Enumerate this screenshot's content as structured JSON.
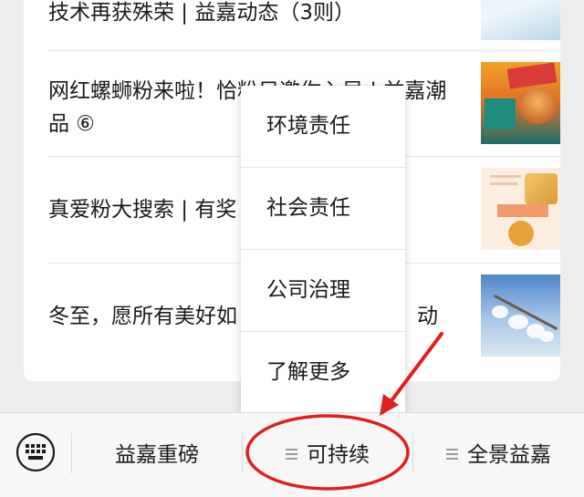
{
  "articles": [
    {
      "title": "技术再获殊荣 | 益嘉动态（3则）"
    },
    {
      "title": "网红螺蛳粉来啦！恰粉只邀你入局 | 益嘉潮品 ⑥"
    },
    {
      "title": "真爱粉大搜索 | 有奖"
    },
    {
      "title": "冬至，愿所有美好如"
    }
  ],
  "obscured_tail": "动",
  "popup_menu": {
    "items": [
      {
        "label": "环境责任"
      },
      {
        "label": "社会责任"
      },
      {
        "label": "公司治理"
      },
      {
        "label": "了解更多"
      }
    ]
  },
  "bottom_bar": {
    "keyboard_icon": "keyboard-icon",
    "buttons": [
      {
        "label": "益嘉重磅",
        "has_menu": false
      },
      {
        "label": "可持续",
        "has_menu": true
      },
      {
        "label": "全景益嘉",
        "has_menu": true
      }
    ]
  },
  "annotation": {
    "color": "#e02020",
    "target": "可持续"
  }
}
